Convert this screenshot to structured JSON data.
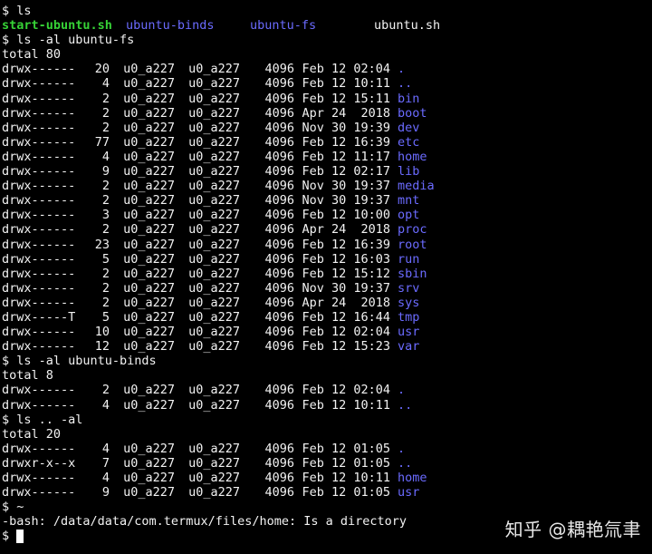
{
  "terminal": {
    "prompt": "$",
    "commands": {
      "ls": "$ ls",
      "ls_fs": "$ ls -al ubuntu-fs",
      "ls_binds": "$ ls -al ubuntu-binds",
      "ls_parent": "$ ls .. -al",
      "tilde": "$ ~",
      "final_prompt": "$"
    },
    "ls_entries": [
      {
        "label": "start-ubuntu.sh",
        "style": "green"
      },
      {
        "label": "ubuntu-binds",
        "style": "blue"
      },
      {
        "label": "ubuntu-fs",
        "style": "blue"
      },
      {
        "label": "ubuntu.sh",
        "style": "white"
      }
    ],
    "fs_total": "total 80",
    "fs_rows": [
      {
        "perm": "drwx------",
        "links": "20",
        "owner": "u0_a227",
        "group": "u0_a227",
        "size": "4096",
        "date": "Feb 12 02:04",
        "name": "."
      },
      {
        "perm": "drwx------",
        "links": "4",
        "owner": "u0_a227",
        "group": "u0_a227",
        "size": "4096",
        "date": "Feb 12 10:11",
        "name": ".."
      },
      {
        "perm": "drwx------",
        "links": "2",
        "owner": "u0_a227",
        "group": "u0_a227",
        "size": "4096",
        "date": "Feb 12 15:11",
        "name": "bin"
      },
      {
        "perm": "drwx------",
        "links": "2",
        "owner": "u0_a227",
        "group": "u0_a227",
        "size": "4096",
        "date": "Apr 24  2018",
        "name": "boot"
      },
      {
        "perm": "drwx------",
        "links": "2",
        "owner": "u0_a227",
        "group": "u0_a227",
        "size": "4096",
        "date": "Nov 30 19:39",
        "name": "dev"
      },
      {
        "perm": "drwx------",
        "links": "77",
        "owner": "u0_a227",
        "group": "u0_a227",
        "size": "4096",
        "date": "Feb 12 16:39",
        "name": "etc"
      },
      {
        "perm": "drwx------",
        "links": "4",
        "owner": "u0_a227",
        "group": "u0_a227",
        "size": "4096",
        "date": "Feb 12 11:17",
        "name": "home"
      },
      {
        "perm": "drwx------",
        "links": "9",
        "owner": "u0_a227",
        "group": "u0_a227",
        "size": "4096",
        "date": "Feb 12 02:17",
        "name": "lib"
      },
      {
        "perm": "drwx------",
        "links": "2",
        "owner": "u0_a227",
        "group": "u0_a227",
        "size": "4096",
        "date": "Nov 30 19:37",
        "name": "media"
      },
      {
        "perm": "drwx------",
        "links": "2",
        "owner": "u0_a227",
        "group": "u0_a227",
        "size": "4096",
        "date": "Nov 30 19:37",
        "name": "mnt"
      },
      {
        "perm": "drwx------",
        "links": "3",
        "owner": "u0_a227",
        "group": "u0_a227",
        "size": "4096",
        "date": "Feb 12 10:00",
        "name": "opt"
      },
      {
        "perm": "drwx------",
        "links": "2",
        "owner": "u0_a227",
        "group": "u0_a227",
        "size": "4096",
        "date": "Apr 24  2018",
        "name": "proc"
      },
      {
        "perm": "drwx------",
        "links": "23",
        "owner": "u0_a227",
        "group": "u0_a227",
        "size": "4096",
        "date": "Feb 12 16:39",
        "name": "root"
      },
      {
        "perm": "drwx------",
        "links": "5",
        "owner": "u0_a227",
        "group": "u0_a227",
        "size": "4096",
        "date": "Feb 12 16:03",
        "name": "run"
      },
      {
        "perm": "drwx------",
        "links": "2",
        "owner": "u0_a227",
        "group": "u0_a227",
        "size": "4096",
        "date": "Feb 12 15:12",
        "name": "sbin"
      },
      {
        "perm": "drwx------",
        "links": "2",
        "owner": "u0_a227",
        "group": "u0_a227",
        "size": "4096",
        "date": "Nov 30 19:37",
        "name": "srv"
      },
      {
        "perm": "drwx------",
        "links": "2",
        "owner": "u0_a227",
        "group": "u0_a227",
        "size": "4096",
        "date": "Apr 24  2018",
        "name": "sys"
      },
      {
        "perm": "drwx-----T",
        "links": "5",
        "owner": "u0_a227",
        "group": "u0_a227",
        "size": "4096",
        "date": "Feb 12 16:44",
        "name": "tmp"
      },
      {
        "perm": "drwx------",
        "links": "10",
        "owner": "u0_a227",
        "group": "u0_a227",
        "size": "4096",
        "date": "Feb 12 02:04",
        "name": "usr"
      },
      {
        "perm": "drwx------",
        "links": "12",
        "owner": "u0_a227",
        "group": "u0_a227",
        "size": "4096",
        "date": "Feb 12 15:23",
        "name": "var"
      }
    ],
    "binds_total": "total 8",
    "binds_rows": [
      {
        "perm": "drwx------",
        "links": "2",
        "owner": "u0_a227",
        "group": "u0_a227",
        "size": "4096",
        "date": "Feb 12 02:04",
        "name": "."
      },
      {
        "perm": "drwx------",
        "links": "4",
        "owner": "u0_a227",
        "group": "u0_a227",
        "size": "4096",
        "date": "Feb 12 10:11",
        "name": ".."
      }
    ],
    "parent_total": "total 20",
    "parent_rows": [
      {
        "perm": "drwx------",
        "links": "4",
        "owner": "u0_a227",
        "group": "u0_a227",
        "size": "4096",
        "date": "Feb 12 01:05",
        "name": "."
      },
      {
        "perm": "drwxr-x--x",
        "links": "7",
        "owner": "u0_a227",
        "group": "u0_a227",
        "size": "4096",
        "date": "Feb 12 01:05",
        "name": ".."
      },
      {
        "perm": "drwx------",
        "links": "4",
        "owner": "u0_a227",
        "group": "u0_a227",
        "size": "4096",
        "date": "Feb 12 10:11",
        "name": "home"
      },
      {
        "perm": "drwx------",
        "links": "9",
        "owner": "u0_a227",
        "group": "u0_a227",
        "size": "4096",
        "date": "Feb 12 01:05",
        "name": "usr"
      }
    ],
    "error": "-bash: /data/data/com.termux/files/home: Is a directory"
  },
  "watermark": "知乎 @耦艳氚聿",
  "colors": {
    "background": "#000000",
    "text": "#f2f2f2",
    "directory": "#6b6bff",
    "executable": "#36d236",
    "cursor": "#ffffff"
  }
}
